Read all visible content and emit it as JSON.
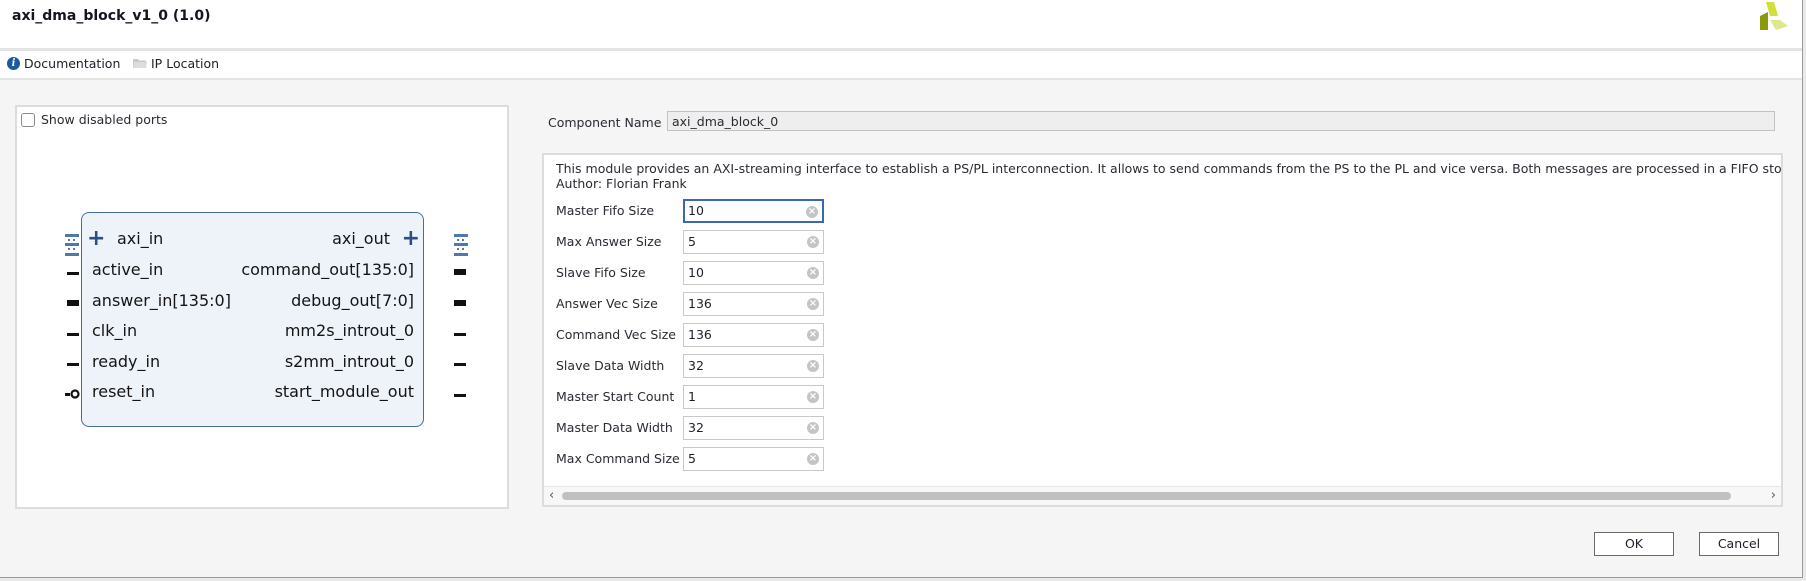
{
  "window": {
    "title": "axi_dma_block_v1_0 (1.0)",
    "logo_icon": "xilinx-logo-icon"
  },
  "toolbar": {
    "documentation_label": "Documentation",
    "documentation_icon": "info-icon",
    "ip_location_label": "IP Location",
    "ip_location_icon": "folder-icon"
  },
  "symbol_panel": {
    "show_disabled_ports_label": "Show disabled ports",
    "show_disabled_ports_checked": false,
    "left_ports": [
      {
        "name": "axi_in",
        "type": "interface"
      },
      {
        "name": "active_in",
        "type": "single"
      },
      {
        "name": "answer_in[135:0]",
        "type": "bus"
      },
      {
        "name": "clk_in",
        "type": "single"
      },
      {
        "name": "ready_in",
        "type": "single"
      },
      {
        "name": "reset_in",
        "type": "inverted"
      }
    ],
    "right_ports": [
      {
        "name": "axi_out",
        "type": "interface"
      },
      {
        "name": "command_out[135:0]",
        "type": "bus"
      },
      {
        "name": "debug_out[7:0]",
        "type": "bus"
      },
      {
        "name": "mm2s_introut_0",
        "type": "single"
      },
      {
        "name": "s2mm_introut_0",
        "type": "single"
      },
      {
        "name": "start_module_out",
        "type": "single"
      }
    ]
  },
  "component": {
    "label": "Component Name",
    "value": "axi_dma_block_0"
  },
  "params_panel": {
    "description": "This module provides an AXI-streaming interface to establish a PS/PL interconnection. It allows to send commands from the PS to the PL and vice versa. Both messages are processed in a FIFO sto",
    "author": "Author: Florian Frank",
    "params": [
      {
        "label": "Master Fifo Size",
        "value": "10"
      },
      {
        "label": "Max Answer Size",
        "value": "5"
      },
      {
        "label": "Slave Fifo Size",
        "value": "10"
      },
      {
        "label": "Answer Vec Size",
        "value": "136"
      },
      {
        "label": "Command Vec Size",
        "value": "136"
      },
      {
        "label": "Slave Data Width",
        "value": "32"
      },
      {
        "label": "Master Start Count",
        "value": "1"
      },
      {
        "label": "Master Data Width",
        "value": "32"
      },
      {
        "label": "Max Command Size",
        "value": "5"
      }
    ],
    "focused_param": "Master Fifo Size",
    "scroll_left_icon": "‹",
    "scroll_right_icon": "›"
  },
  "footer": {
    "ok_label": "OK",
    "cancel_label": "Cancel"
  }
}
